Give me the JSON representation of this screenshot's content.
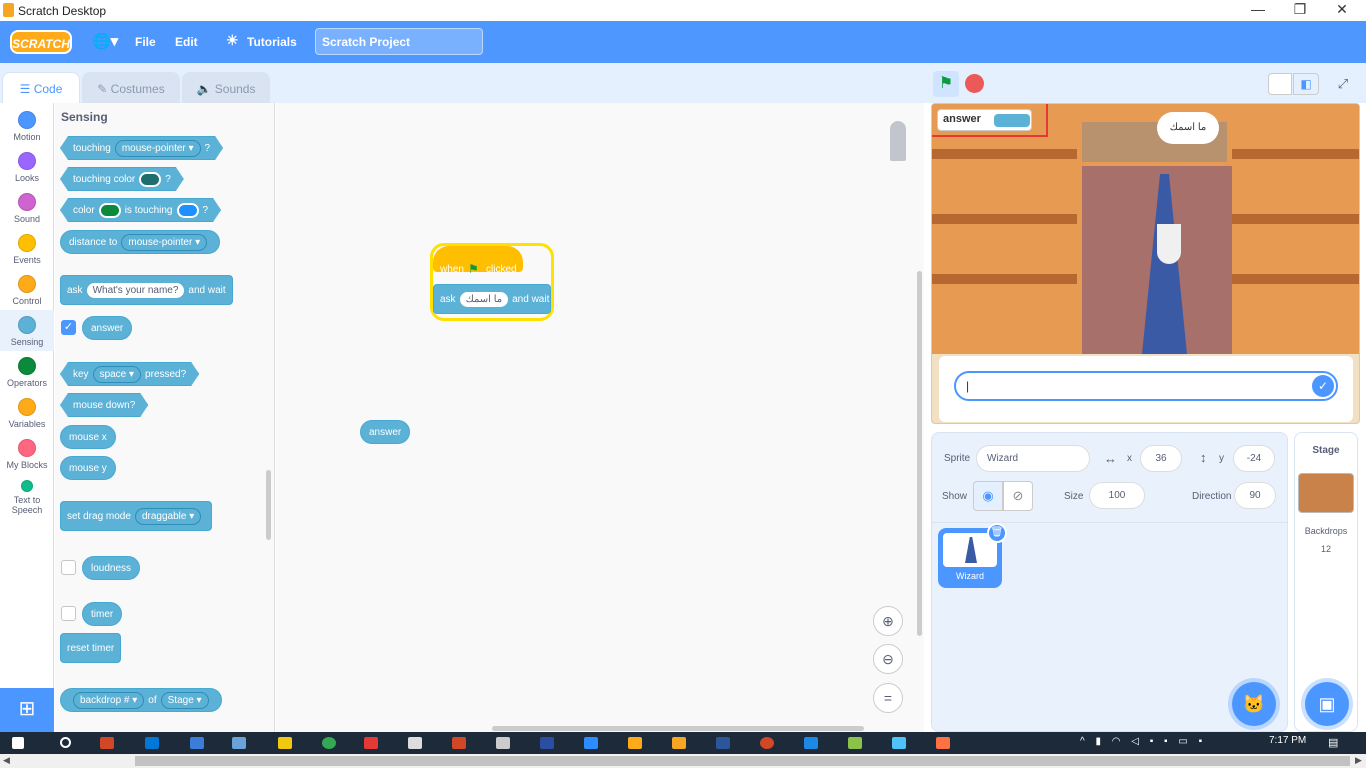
{
  "window": {
    "title": "Scratch Desktop",
    "minimize": "—",
    "restore": "❐",
    "close": "✕"
  },
  "menubar": {
    "logo": "SCRATCH",
    "file": "File",
    "edit": "Edit",
    "tutorials": "Tutorials",
    "project_name": "Scratch Project"
  },
  "tabs": {
    "code": "Code",
    "costumes": "Costumes",
    "sounds": "Sounds"
  },
  "categories": [
    {
      "label": "Motion",
      "color": "#4c97ff"
    },
    {
      "label": "Looks",
      "color": "#9966ff"
    },
    {
      "label": "Sound",
      "color": "#cf63cf"
    },
    {
      "label": "Events",
      "color": "#ffbf00"
    },
    {
      "label": "Control",
      "color": "#ffab19"
    },
    {
      "label": "Sensing",
      "color": "#5cb1d6"
    },
    {
      "label": "Operators",
      "color": "#59c059"
    },
    {
      "label": "Variables",
      "color": "#ff8c1a"
    },
    {
      "label": "My Blocks",
      "color": "#ff6680"
    },
    {
      "label": "Text to Speech",
      "color": "#0fbd8c"
    }
  ],
  "palette": {
    "title": "Sensing",
    "touching": "touching",
    "touching_target": "mouse-pointer ▾",
    "q": "?",
    "touching_color": "touching color",
    "color": "color",
    "is_touching": "is touching",
    "distance_to": "distance to",
    "distance_target": "mouse-pointer ▾",
    "ask": "ask",
    "ask_default": "What's your name?",
    "and_wait": "and wait",
    "answer": "answer",
    "key": "key",
    "key_val": "space ▾",
    "pressed": "pressed?",
    "mouse_down": "mouse down?",
    "mouse_x": "mouse x",
    "mouse_y": "mouse y",
    "set_drag": "set drag mode",
    "drag_val": "draggable ▾",
    "loudness": "loudness",
    "timer": "timer",
    "reset_timer": "reset timer",
    "backdrop": "backdrop # ▾",
    "of": "of",
    "stage": "Stage ▾"
  },
  "workspace": {
    "when": "when",
    "clicked": "clicked",
    "ask": "ask",
    "ask_text": "ما اسمك",
    "and_wait": "and wait",
    "answer_reporter": "answer"
  },
  "stage": {
    "monitor_label": "answer",
    "speech": "ما اسمك",
    "input_value": "|"
  },
  "sprite_info": {
    "sprite_label": "Sprite",
    "sprite_name": "Wizard",
    "x_label": "x",
    "x": "36",
    "y_label": "y",
    "y": "-24",
    "show_label": "Show",
    "size_label": "Size",
    "size": "100",
    "direction_label": "Direction",
    "direction": "90",
    "thumb_name": "Wizard"
  },
  "stage_pane": {
    "title": "Stage",
    "backdrops_label": "Backdrops",
    "backdrops_count": "12"
  },
  "taskbar": {
    "time": "7:17 PM"
  }
}
